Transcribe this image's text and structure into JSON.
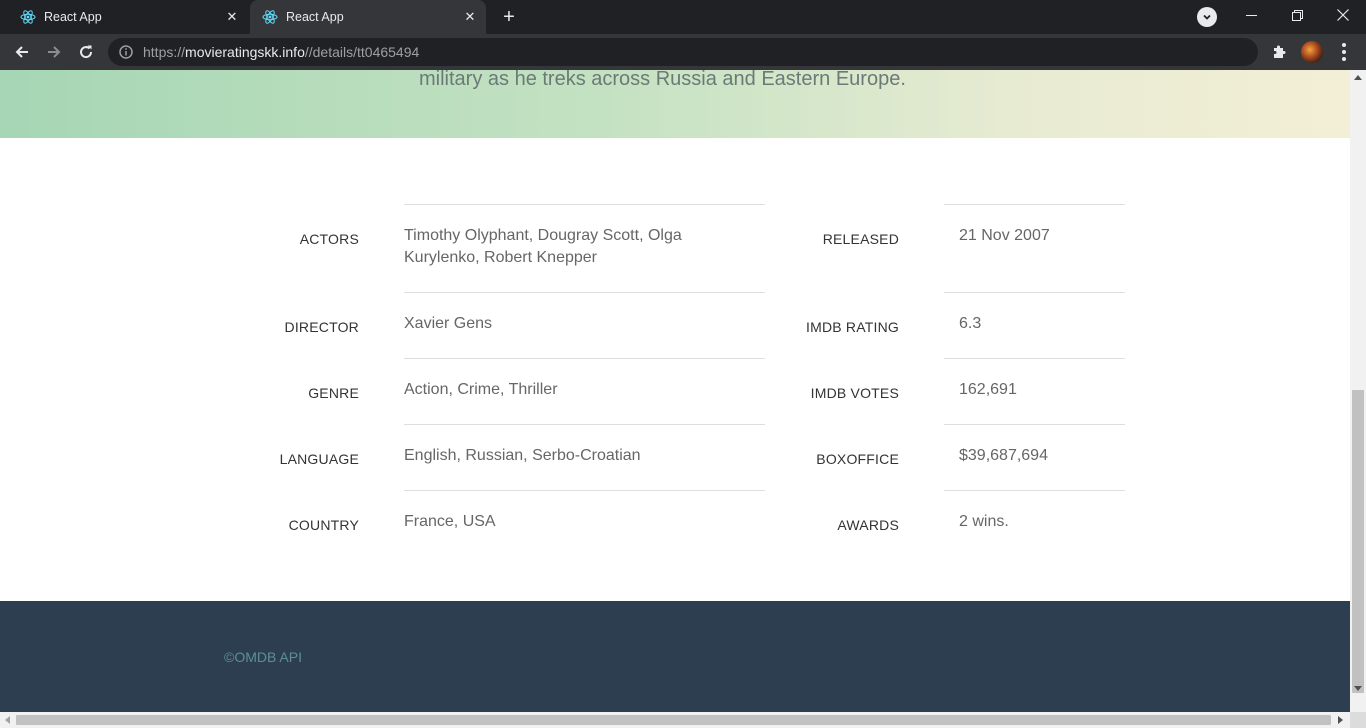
{
  "browser": {
    "tabs": [
      {
        "title": "React App",
        "active": false,
        "icon": "react-icon"
      },
      {
        "title": "React App",
        "active": true,
        "icon": "react-icon"
      }
    ],
    "url": {
      "scheme": "https://",
      "host": "movieratingskk.info",
      "path": "//details/tt0465494"
    }
  },
  "hero": {
    "plot_tail": "military as he treks across Russia and Eastern Europe."
  },
  "details": {
    "left": [
      {
        "label": "ACTORS",
        "value": "Timothy Olyphant, Dougray Scott, Olga Kurylenko, Robert Knepper"
      },
      {
        "label": "DIRECTOR",
        "value": "Xavier Gens"
      },
      {
        "label": "GENRE",
        "value": "Action, Crime, Thriller"
      },
      {
        "label": "LANGUAGE",
        "value": "English, Russian, Serbo-Croatian"
      },
      {
        "label": "COUNTRY",
        "value": "France, USA"
      }
    ],
    "right": [
      {
        "label": "RELEASED",
        "value": "21 Nov 2007"
      },
      {
        "label": "IMDB RATING",
        "value": "6.3"
      },
      {
        "label": "IMDB VOTES",
        "value": "162,691"
      },
      {
        "label": "BOXOFFICE",
        "value": "$39,687,694"
      },
      {
        "label": "AWARDS",
        "value": "2 wins."
      }
    ]
  },
  "footer": {
    "copyright": "©OMDB API"
  },
  "colors": {
    "footer_bg": "#2c3e50",
    "footer_text": "#5c8f98",
    "hero_start": "#a6d6b5",
    "hero_end": "#f3efd6"
  }
}
